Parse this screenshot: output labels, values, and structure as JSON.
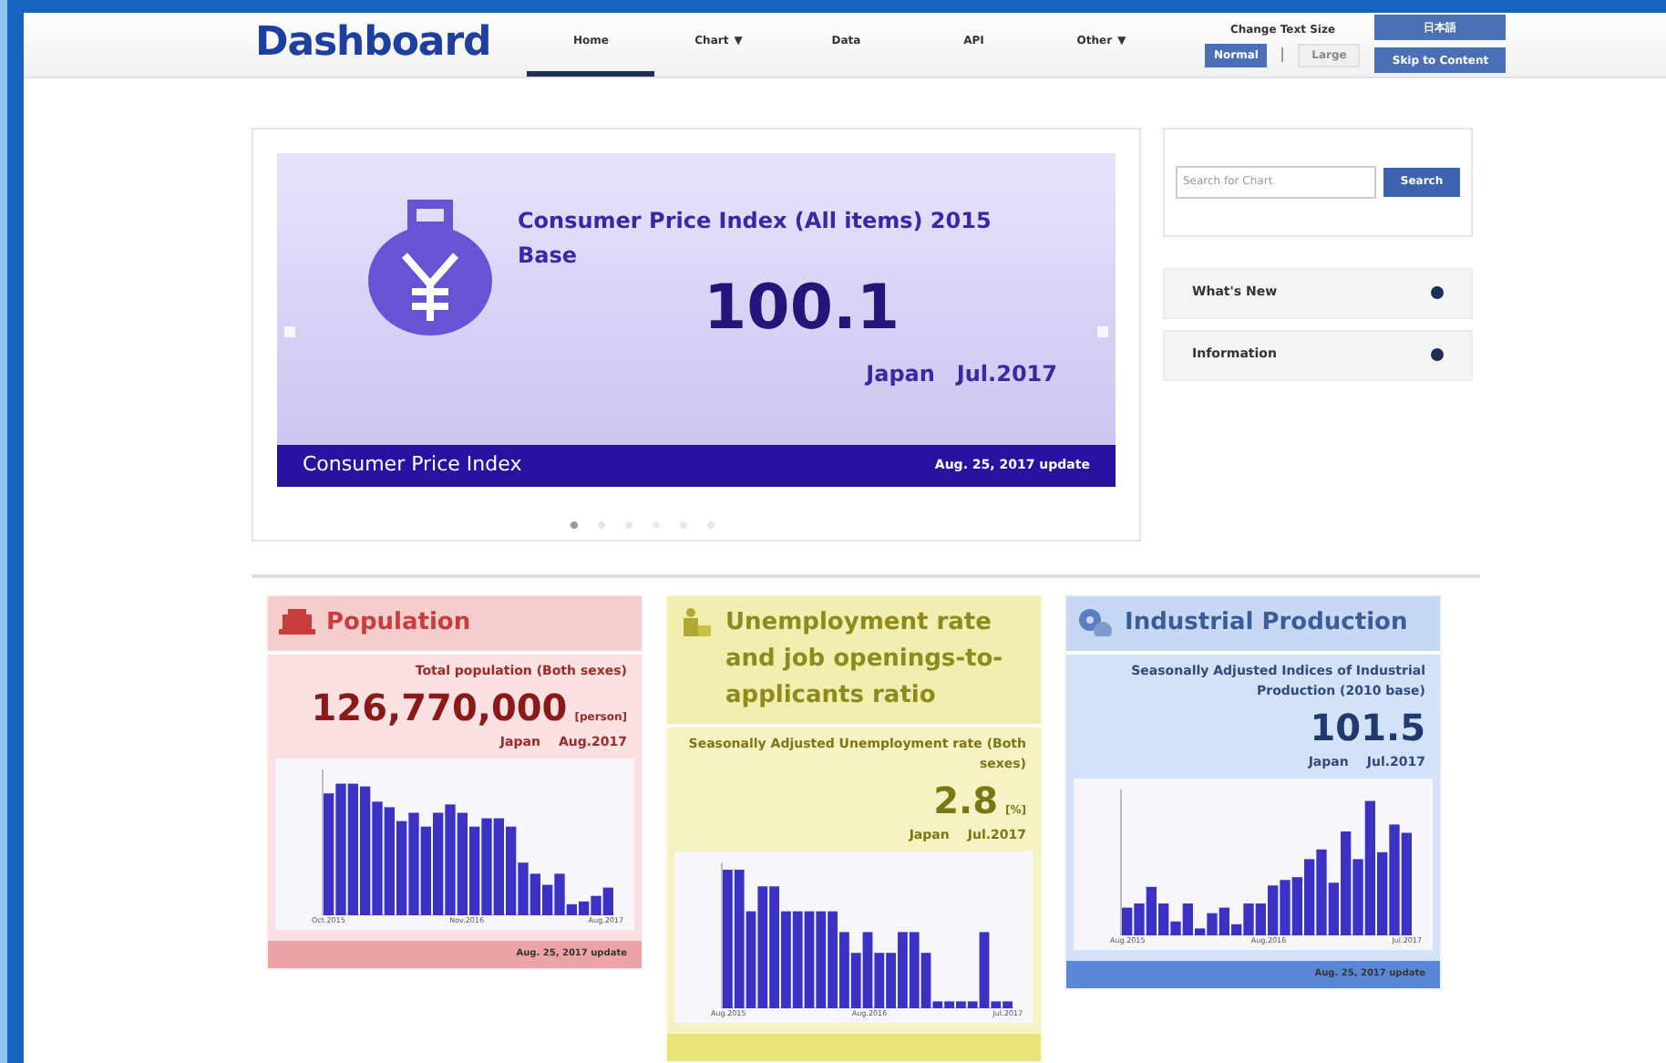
{
  "header": {
    "logo": "Dashboard",
    "nav": [
      {
        "label": "Home",
        "selected": true
      },
      {
        "label": "Chart",
        "selected": false,
        "caret": "▼"
      },
      {
        "label": "Data",
        "selected": false
      },
      {
        "label": "API",
        "selected": false
      },
      {
        "label": "Other",
        "selected": false,
        "caret": "▼"
      }
    ],
    "text_size": {
      "label": "Change Text Size",
      "buttons": [
        {
          "label": "Normal",
          "selected": true
        },
        {
          "label": "Large",
          "selected": false
        }
      ]
    },
    "language_button": "日本語",
    "skip_link": "Skip to Content"
  },
  "carousel": {
    "title": "Consumer Price Index (All items) 2015 Base",
    "value": "100.1",
    "place": "Japan",
    "date": "Jul.2017",
    "footer_title": "Consumer Price Index",
    "update": "Aug. 25, 2017 update",
    "dots": [
      {
        "selected": true
      },
      {
        "selected": false
      },
      {
        "selected": false
      },
      {
        "selected": false
      },
      {
        "selected": false
      },
      {
        "selected": false
      }
    ]
  },
  "search": {
    "placeholder": "Search for Chart",
    "button": "Search"
  },
  "panels": [
    {
      "label": "What's New"
    },
    {
      "label": "Information"
    }
  ],
  "cards": [
    {
      "kind": "population",
      "title": "Population",
      "subtitle": "Total population (Both sexes)",
      "value": "126,770,000",
      "unit": "[person]",
      "place": "Japan",
      "date": "Aug.2017",
      "x_labels": [
        "Oct.2015",
        "Nov.2016",
        "Aug.2017"
      ],
      "update": "Aug. 25, 2017 update"
    },
    {
      "kind": "employment",
      "title": "Unemployment rate and job openings-to-applicants ratio",
      "subtitle": "Seasonally Adjusted Unemployment rate (Both sexes)",
      "value": "2.8",
      "unit": "[%]",
      "place": "Japan",
      "date": "Jul.2017",
      "x_labels": [
        "Aug.2015",
        "Aug.2016",
        "Jul.2017"
      ]
    },
    {
      "kind": "industry",
      "title": "Industrial Production",
      "subtitle": "Seasonally Adjusted Indices of Industrial Production (2010 base)",
      "value": "101.5",
      "place": "Japan",
      "date": "Jul.2017",
      "x_labels": [
        "Aug.2015",
        "Aug.2016",
        "Jul.2017"
      ],
      "update": "Aug. 25, 2017 update"
    }
  ]
}
